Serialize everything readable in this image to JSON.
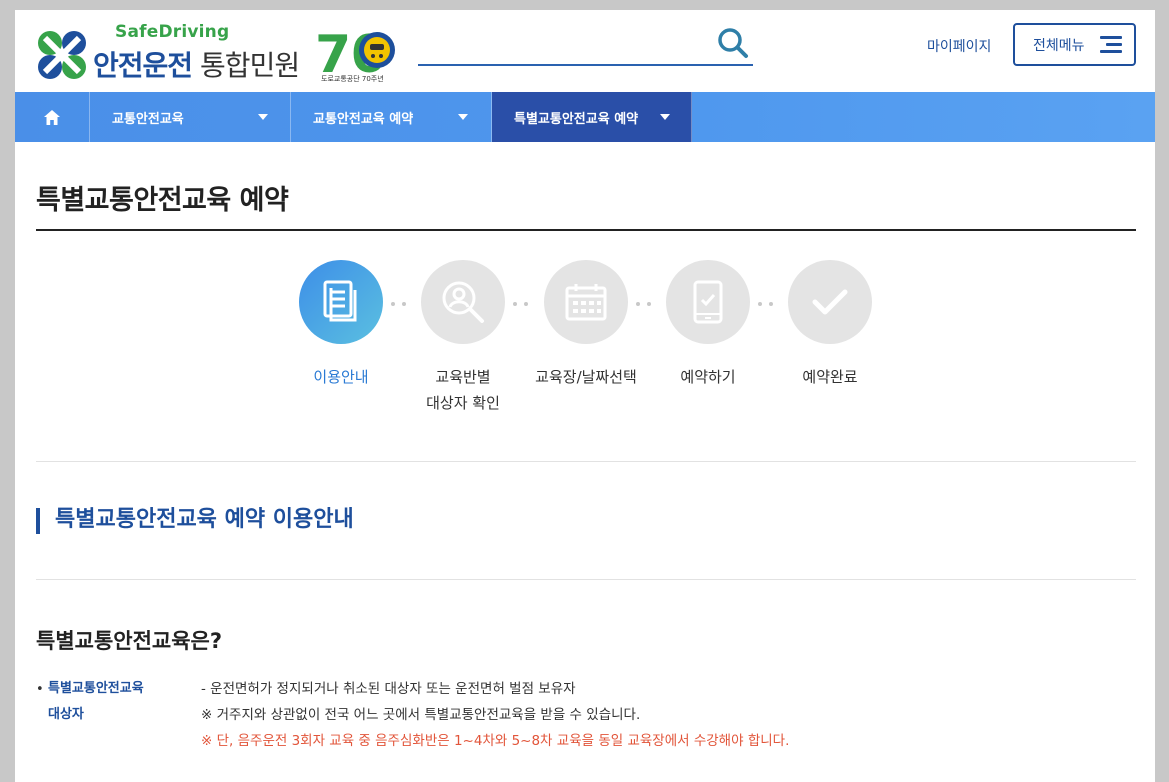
{
  "header": {
    "logo": {
      "brand_en": "SafeDriving",
      "brand_ko_bold": "안전운전",
      "brand_ko_light": "통합민원",
      "anniversary_number": "70",
      "anniversary_sub": "도로교통공단 70주년"
    },
    "search": {
      "placeholder": ""
    },
    "mypage_label": "마이페이지",
    "allmenu_label": "전체메뉴"
  },
  "nav": {
    "items": [
      {
        "label": "교통안전교육"
      },
      {
        "label": "교통안전교육 예약"
      },
      {
        "label": "특별교통안전교육 예약"
      }
    ]
  },
  "page": {
    "title": "특별교통안전교육 예약"
  },
  "steps": [
    {
      "label_line1": "이용안내",
      "label_line2": "",
      "icon": "document-icon",
      "active": true
    },
    {
      "label_line1": "교육반별",
      "label_line2": "대상자 확인",
      "icon": "person-search-icon",
      "active": false
    },
    {
      "label_line1": "교육장/날짜선택",
      "label_line2": "",
      "icon": "calendar-icon",
      "active": false
    },
    {
      "label_line1": "예약하기",
      "label_line2": "",
      "icon": "mobile-check-icon",
      "active": false
    },
    {
      "label_line1": "예약완료",
      "label_line2": "",
      "icon": "checkmark-icon",
      "active": false
    }
  ],
  "section": {
    "heading": "특별교통안전교육 예약 이용안내",
    "subheading": "특별교통안전교육은?",
    "info": {
      "bullet": "•",
      "label_line1": "특별교통안전교육",
      "label_line2": "대상자",
      "line1": "- 운전면허가 정지되거나 취소된 대상자 또는 운전면허 벌점 보유자",
      "line2": "※ 거주지와 상관없이 전국 어느 곳에서 특별교통안전교육을 받을 수 있습니다.",
      "line3": "※ 단, 음주운전 3회자 교육 중 음주심화반은 1~4차와 5~8차 교육을 동일 교육장에서 수강해야 합니다."
    }
  },
  "colors": {
    "brand_blue": "#1e4f9c",
    "brand_green": "#37a34a",
    "nav_blue": "#4f98ee",
    "nav_active": "#2a4fa8",
    "step_active": "#3d8ee8",
    "warning": "#e2553a"
  }
}
